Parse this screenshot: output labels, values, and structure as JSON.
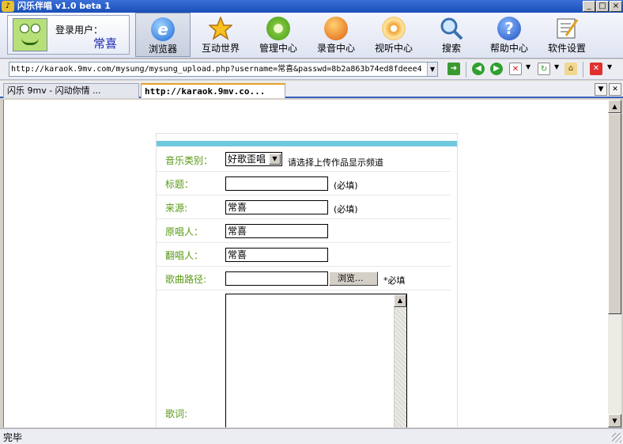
{
  "window": {
    "title": "闪乐伴唱 v1.0 beta 1",
    "buttons": [
      "_",
      "□",
      "×"
    ]
  },
  "user": {
    "label": "登录用户：",
    "name": "常喜"
  },
  "toolbar": [
    {
      "label": "浏览器",
      "icon": "browser-icon",
      "active": true
    },
    {
      "label": "互动世界",
      "icon": "star-icon"
    },
    {
      "label": "管理中心",
      "icon": "gear-icon"
    },
    {
      "label": "录音中心",
      "icon": "microphone-icon"
    },
    {
      "label": "视听中心",
      "icon": "cd-icon"
    },
    {
      "label": "搜索",
      "icon": "magnifier-icon"
    },
    {
      "label": "帮助中心",
      "icon": "help-icon"
    },
    {
      "label": "软件设置",
      "icon": "settings-icon"
    }
  ],
  "address": {
    "url": "http://karaok.9mv.com/mysung/mysung_upload.php?username=常喜&passwd=8b2a863b74ed8fdeee4"
  },
  "tabs": [
    {
      "label": "闪乐 9mv - 闪动你情 ..."
    },
    {
      "label": "http://karaok.9mv.co..."
    }
  ],
  "form": {
    "category": {
      "label": "音乐类别：",
      "selected": "好歌歪唱",
      "hint": "请选择上传作品显示频道"
    },
    "title": {
      "label": "标题：",
      "value": "",
      "note": "(必填)"
    },
    "source": {
      "label": "来源:",
      "value": "常喜",
      "note": "(必填)"
    },
    "original_singer": {
      "label": "原唱人：",
      "value": "常喜"
    },
    "cover_singer": {
      "label": "翻唱人：",
      "value": "常喜"
    },
    "song_path": {
      "label": "歌曲路径:",
      "value": "",
      "browse": "浏览...",
      "note": "*必填"
    },
    "lyrics": {
      "label": "歌词:"
    }
  },
  "status": {
    "text": "完毕"
  }
}
